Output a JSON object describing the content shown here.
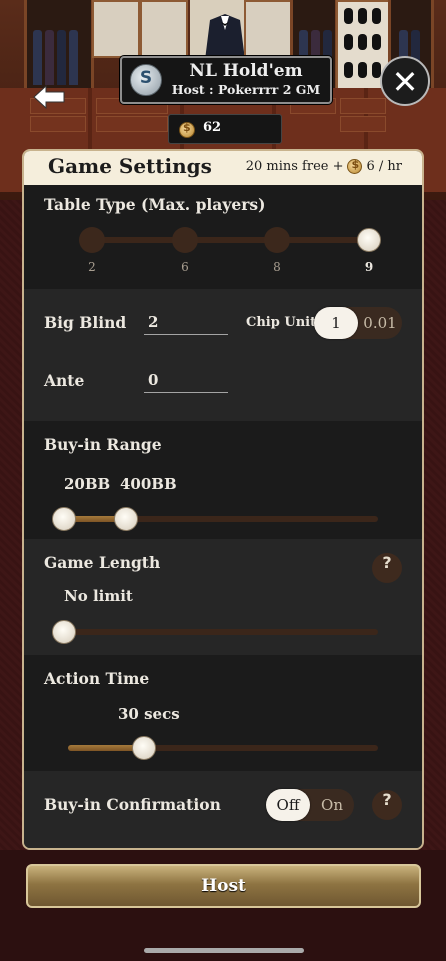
{
  "header": {
    "title": "NL Hold'em",
    "host_line": "Host : Pokerrrr 2 GM",
    "coins": "62"
  },
  "panel": {
    "title": "Game Settings",
    "fee_free": "20 mins free +",
    "fee_rate": "6 / hr"
  },
  "table_type": {
    "label": "Table Type (Max. players)",
    "options": [
      "2",
      "6",
      "8",
      "9"
    ],
    "selected": "9"
  },
  "big_blind": {
    "label": "Big Blind",
    "value": "2"
  },
  "chip_unit": {
    "label": "Chip Unit",
    "options": [
      "1",
      "0.01"
    ],
    "selected": "1"
  },
  "ante": {
    "label": "Ante",
    "value": "0"
  },
  "buy_in": {
    "label": "Buy-in Range",
    "min": "20BB",
    "max": "400BB"
  },
  "game_length": {
    "label": "Game Length",
    "value": "No limit"
  },
  "action_time": {
    "label": "Action Time",
    "value": "30 secs"
  },
  "buy_in_confirmation": {
    "label": "Buy-in Confirmation",
    "options": [
      "Off",
      "On"
    ],
    "selected": "Off"
  },
  "host_button": "Host",
  "icons": {
    "back": "back-arrow-icon",
    "close": "close-icon",
    "coin": "coin-icon",
    "help": "help-icon",
    "logo": "club-logo-icon"
  },
  "help_glyph": "?",
  "close_glyph": "✕",
  "logo_glyph": "S",
  "colors": {
    "panel_bg": "#1c1c1c",
    "header_bg": "#f5eedc",
    "accent_gold": "#a57a3c",
    "button_gold": "#8e7442"
  }
}
